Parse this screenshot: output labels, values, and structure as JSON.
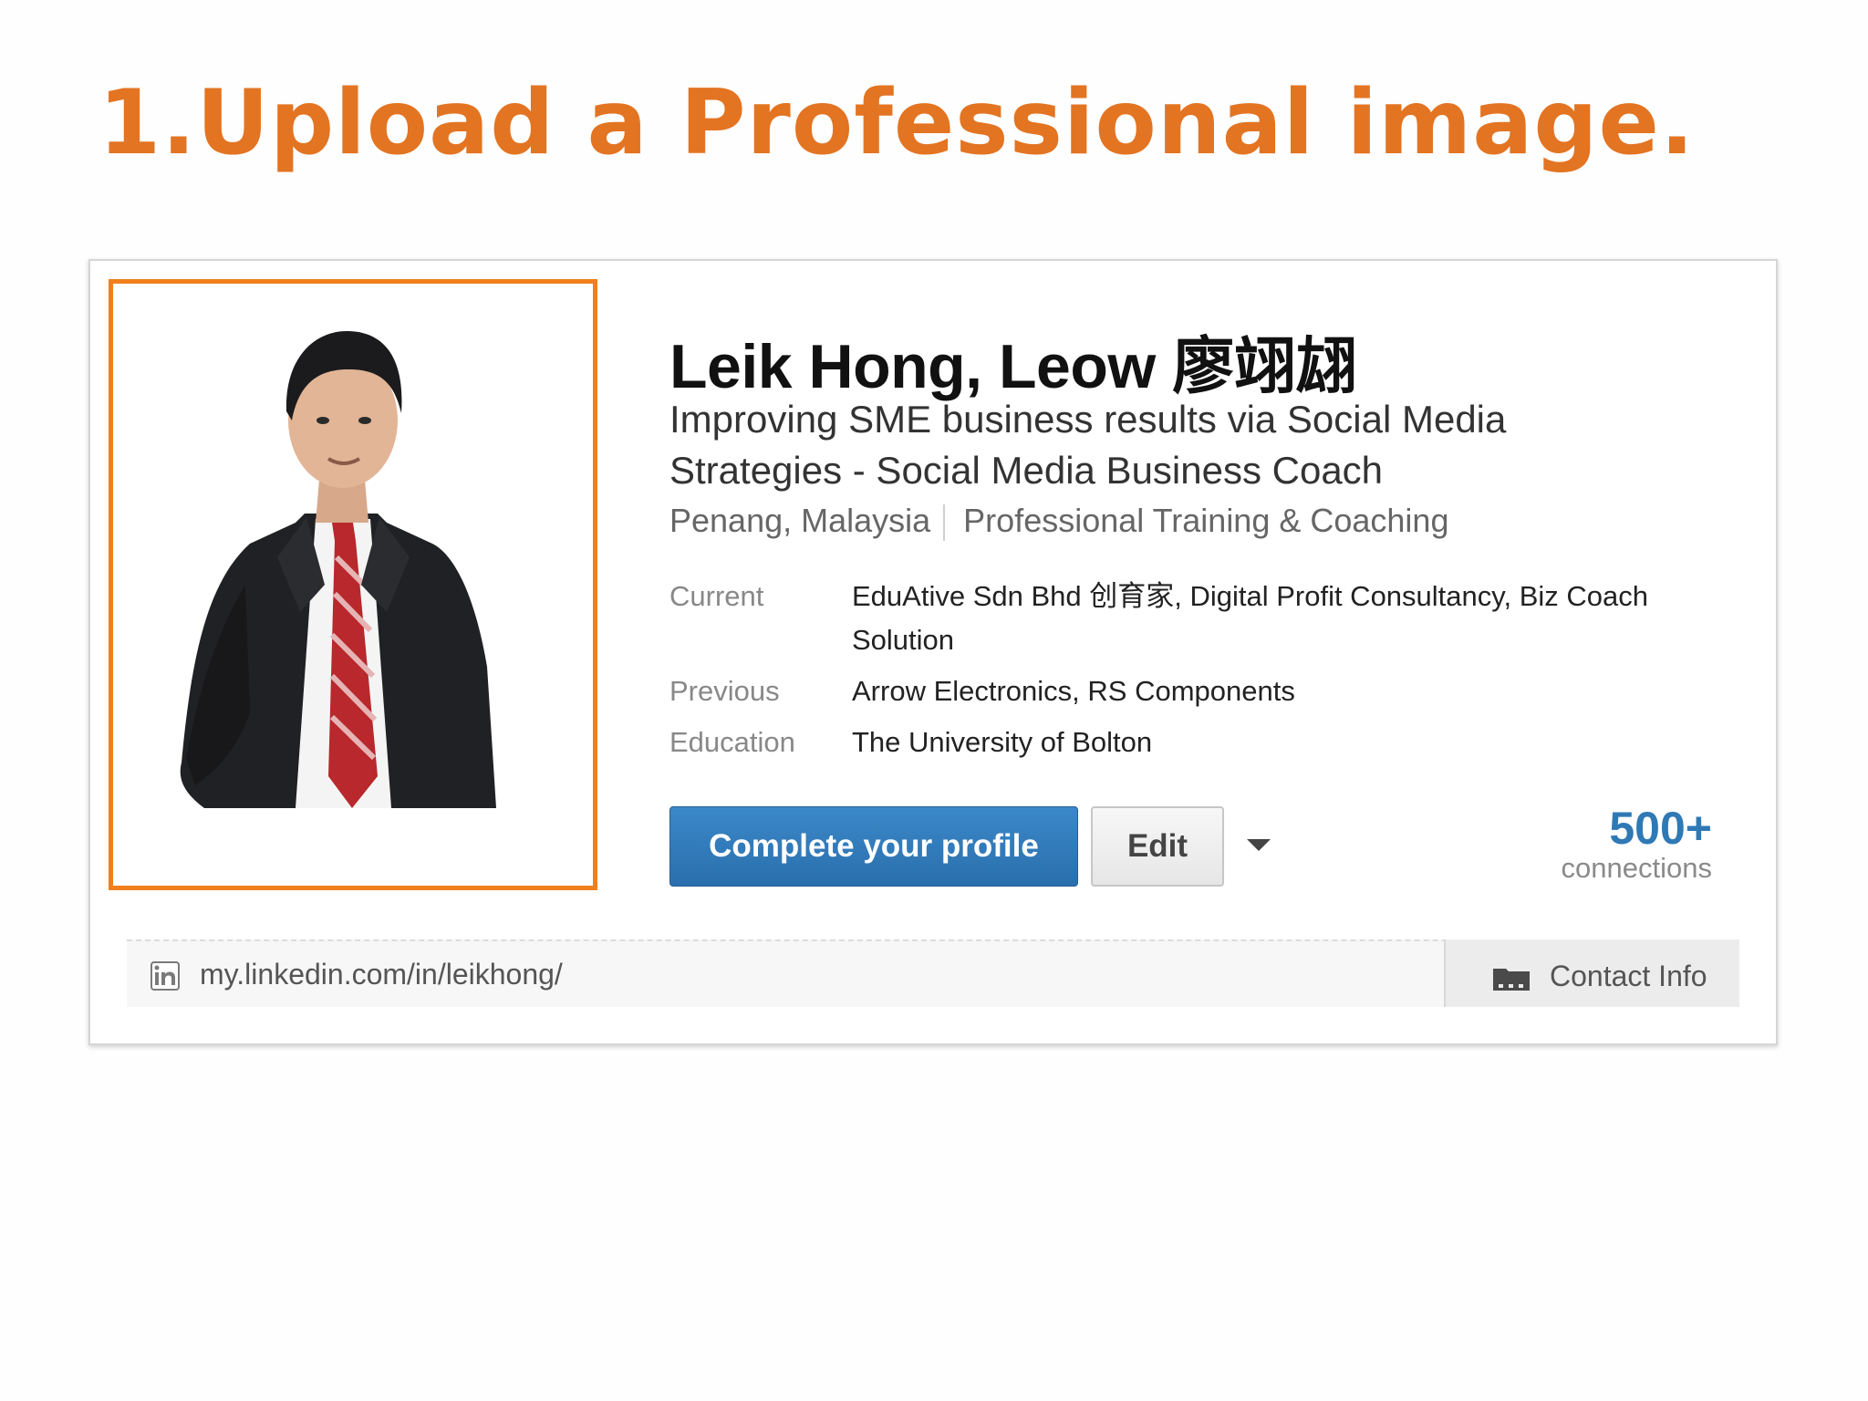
{
  "slide": {
    "title": "1.Upload a Professional image."
  },
  "profile": {
    "name": "Leik Hong, Leow 廖翊翃",
    "headline": "Improving SME business results via Social Media Strategies - Social Media Business Coach",
    "location": "Penang, Malaysia",
    "industry": "Professional Training & Coaching",
    "details": [
      {
        "label": "Current",
        "value": "EduAtive Sdn Bhd 创育家, Digital Profit Consultancy, Biz Coach Solution"
      },
      {
        "label": "Previous",
        "value": "Arrow Electronics, RS Components"
      },
      {
        "label": "Education",
        "value": "The University of Bolton"
      }
    ],
    "photo_icon": "profile-photo"
  },
  "actions": {
    "complete_label": "Complete your profile",
    "edit_label": "Edit",
    "dropdown_icon": "caret-down-icon"
  },
  "connections": {
    "count": "500+",
    "label": "connections"
  },
  "footer": {
    "url": "my.linkedin.com/in/leikhong/",
    "url_icon": "linkedin-icon",
    "contact_label": "Contact Info",
    "contact_icon": "address-book-icon"
  },
  "colors": {
    "title": "#e37422",
    "photo_border": "#f07f1c",
    "primary_button": "#2a6fad",
    "connections": "#2f79b5"
  }
}
